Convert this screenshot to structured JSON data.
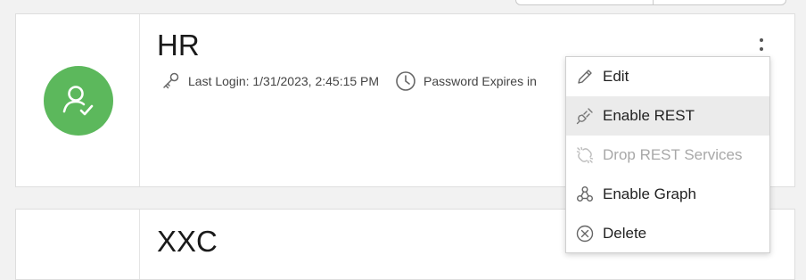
{
  "cards": [
    {
      "name": "HR",
      "last_login": "Last Login: 1/31/2023, 2:45:15 PM",
      "password_expiry": "Password Expires in",
      "avatar_color": "#5cb85c",
      "icons": {
        "avatar": "user-check-icon",
        "login": "key-icon",
        "expiry": "clock-icon",
        "menu": "kebab-icon"
      }
    },
    {
      "name": "XXC"
    }
  ],
  "context_menu": {
    "items": [
      {
        "label": "Edit",
        "icon": "pencil-icon",
        "state": "enabled"
      },
      {
        "label": "Enable REST",
        "icon": "plug-icon",
        "state": "hovered"
      },
      {
        "label": "Drop REST Services",
        "icon": "unplug-icon",
        "state": "disabled"
      },
      {
        "label": "Enable Graph",
        "icon": "graph-icon",
        "state": "enabled"
      },
      {
        "label": "Delete",
        "icon": "delete-circle-icon",
        "state": "enabled"
      }
    ]
  }
}
